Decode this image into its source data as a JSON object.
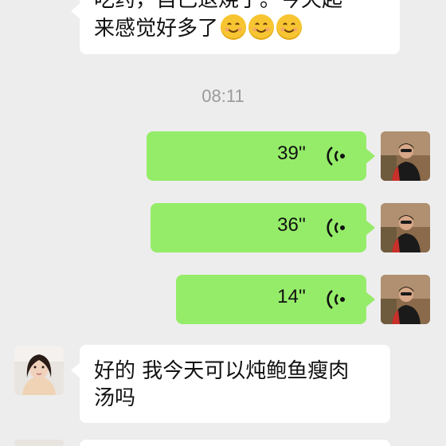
{
  "messages": [
    {
      "side": "left",
      "lines": [
        "吃药，自己退烧了。今天起",
        "来感觉好多了"
      ],
      "emoji_count": 3
    },
    {
      "type": "time",
      "text": "08:11"
    },
    {
      "side": "right",
      "type": "voice",
      "duration": "39''"
    },
    {
      "side": "right",
      "type": "voice",
      "duration": "36''"
    },
    {
      "side": "right",
      "type": "voice",
      "duration": "14''"
    },
    {
      "side": "left",
      "lines": [
        "好的 我今天可以炖鲍鱼瘦肉",
        "汤吗"
      ]
    }
  ],
  "colors": {
    "background": "#ededed",
    "sent_bubble": "#95ec69",
    "received_bubble": "#ffffff",
    "time": "#9a9a9a"
  },
  "icons": [
    "voice-wave-icon",
    "smile-emoji-icon",
    "contact-avatar",
    "self-avatar"
  ]
}
